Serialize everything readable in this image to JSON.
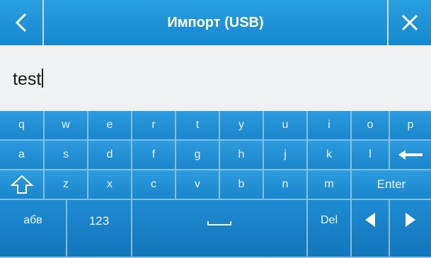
{
  "header": {
    "title": "Импорт (USB)",
    "back_icon": "chevron-left-icon",
    "close_icon": "close-icon"
  },
  "input": {
    "value": "test"
  },
  "keyboard": {
    "row1": [
      "q",
      "w",
      "e",
      "r",
      "t",
      "y",
      "u",
      "i",
      "o",
      "p"
    ],
    "row2": [
      "a",
      "s",
      "d",
      "f",
      "g",
      "h",
      "j",
      "k",
      "l"
    ],
    "backspace_icon": "backspace-arrow-icon",
    "row3": [
      "z",
      "x",
      "c",
      "v",
      "b",
      "n",
      "m"
    ],
    "shift_icon": "shift-arrow-icon",
    "enter_label": "Enter",
    "alpha_label": "абв",
    "numeric_label": "123",
    "space_icon": "space-bar-icon",
    "delete_label": "Del",
    "left_icon": "arrow-left-icon",
    "right_icon": "arrow-right-icon"
  },
  "colors": {
    "accent": "#1a86cc",
    "key_border": "#7fc1ea",
    "input_bg": "#f0f1f2"
  }
}
